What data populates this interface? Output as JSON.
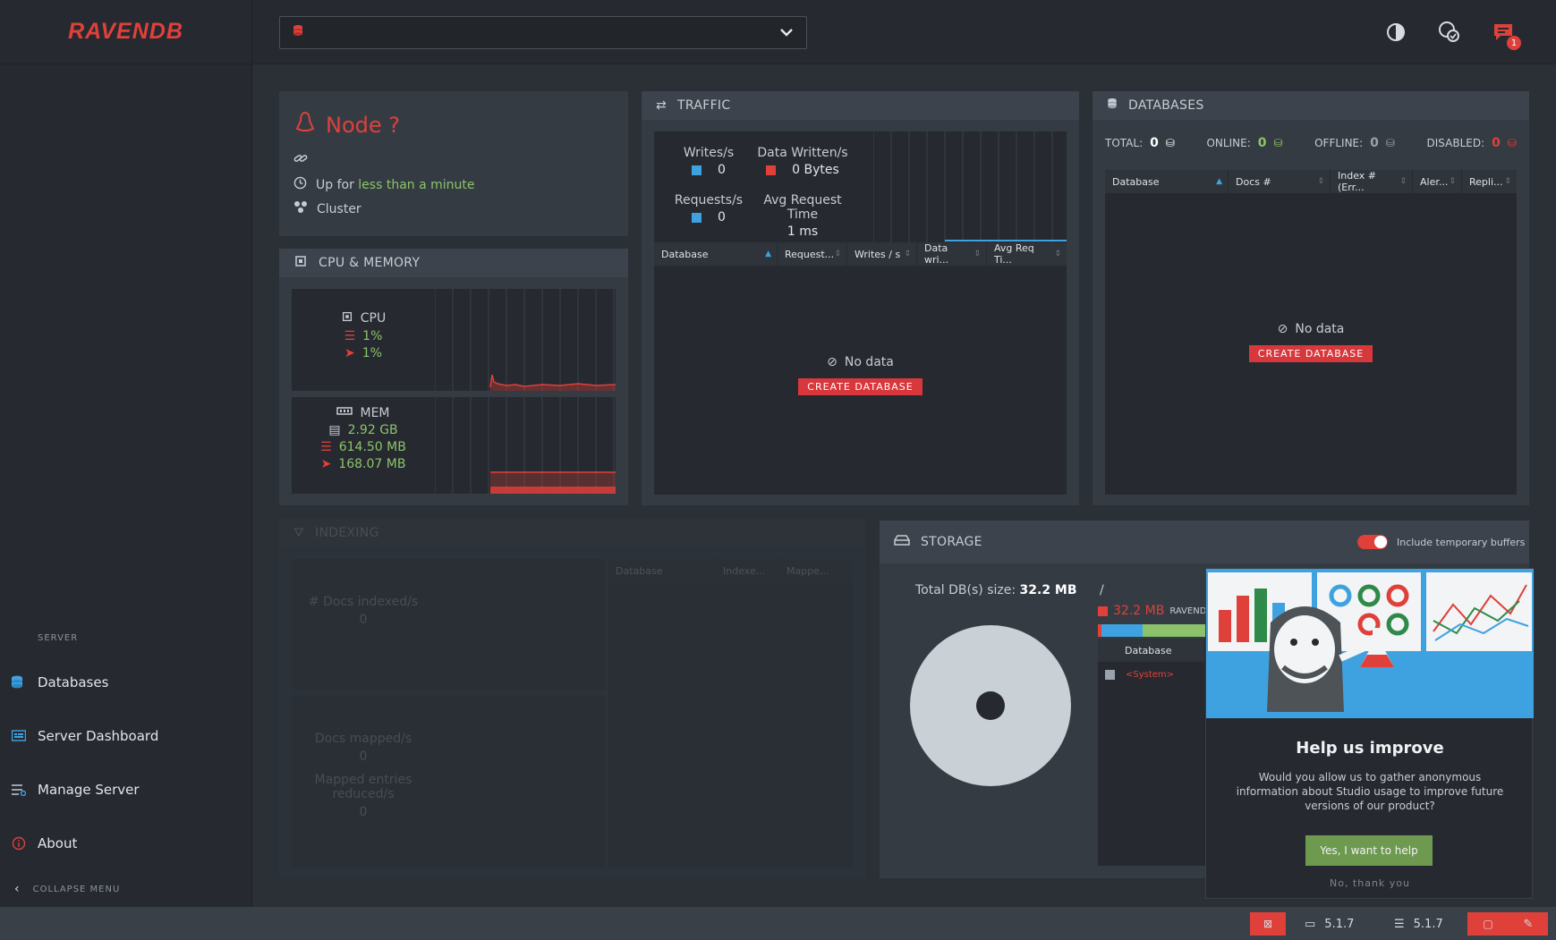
{
  "app": {
    "logo": "RAVENDB"
  },
  "sidebar": {
    "section_label": "SERVER",
    "items": [
      {
        "label": "Databases",
        "icon": "databases-icon"
      },
      {
        "label": "Server Dashboard",
        "icon": "dashboard-icon"
      },
      {
        "label": "Manage Server",
        "icon": "manage-server-icon"
      },
      {
        "label": "About",
        "icon": "about-icon"
      }
    ],
    "collapse_label": "COLLAPSE MENU"
  },
  "topbar": {
    "database_select_value": ""
  },
  "node": {
    "title": "Node ?",
    "uptime_prefix": "Up for",
    "uptime_value": "less than a minute",
    "cluster_label": "Cluster"
  },
  "cpu_memory": {
    "title": "CPU & MEMORY",
    "cpu_label": "CPU",
    "cpu_machine": "1%",
    "cpu_process": "1%",
    "mem_label": "MEM",
    "mem_total": "2.92 GB",
    "mem_machine": "614.50 MB",
    "mem_process": "168.07 MB"
  },
  "traffic": {
    "title": "TRAFFIC",
    "writes_label": "Writes/s",
    "writes_value": "0",
    "data_written_label": "Data Written/s",
    "data_written_value": "0 Bytes",
    "requests_label": "Requests/s",
    "requests_value": "0",
    "avg_req_label": "Avg Request Time",
    "avg_req_value": "1 ms",
    "columns": [
      "Database",
      "Request...",
      "Writes / s",
      "Data wri...",
      "Avg Req Ti..."
    ],
    "no_data": "No data",
    "create_button": "CREATE DATABASE"
  },
  "databases": {
    "title": "DATABASES",
    "total_label": "TOTAL:",
    "total_value": "0",
    "online_label": "ONLINE:",
    "online_value": "0",
    "offline_label": "OFFLINE:",
    "offline_value": "0",
    "disabled_label": "DISABLED:",
    "disabled_value": "0",
    "columns": [
      "Database",
      "Docs #",
      "Index # (Err...",
      "Aler...",
      "Repli..."
    ],
    "no_data": "No data",
    "create_button": "CREATE DATABASE"
  },
  "indexing": {
    "title": "INDEXING",
    "docs_indexed_label": "# Docs indexed/s",
    "docs_indexed_value": "0",
    "docs_mapped_label": "Docs mapped/s",
    "docs_mapped_value": "0",
    "mapped_reduced_label": "Mapped entries reduced/s",
    "mapped_reduced_value": "0",
    "columns": [
      "Database",
      "Indexe...",
      "Mappe..."
    ]
  },
  "storage": {
    "title": "STORAGE",
    "toggle_label": "Include temporary buffers",
    "total_label": "Total DB(s) size:",
    "total_value": "32.2 MB",
    "slash": "/",
    "legend_value": "32.2 MB",
    "legend_name": "RAVENDB",
    "columns": [
      "Database"
    ],
    "rows": [
      "<System>"
    ]
  },
  "popup": {
    "title": "Help us improve",
    "text": "Would you allow us to gather anonymous information about Studio usage to improve future versions of our product?",
    "yes_button": "Yes, I want to help",
    "no_button": "No, thank you"
  },
  "footer": {
    "studio_version": "5.1.7",
    "server_version": "5.1.7"
  },
  "colors": {
    "accent_red": "#e0403a",
    "accent_green": "#8cc36a",
    "accent_blue": "#3fa2e0"
  }
}
